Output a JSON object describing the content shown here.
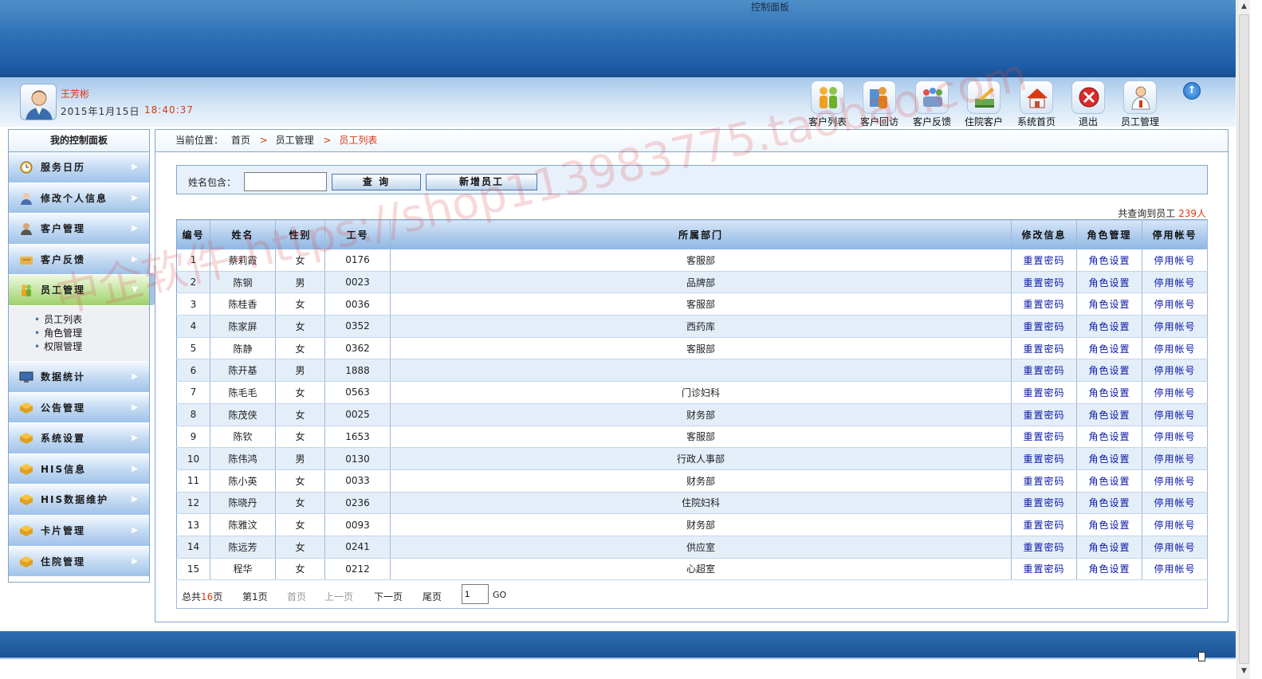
{
  "banner": {
    "title": "控制面板"
  },
  "user": {
    "name": "王芳彬",
    "date": "2015年1月15日",
    "time": "18:40:37"
  },
  "toolbar": [
    {
      "label": "客户列表",
      "icon": "customer-list-icon"
    },
    {
      "label": "客户回访",
      "icon": "customer-visit-icon"
    },
    {
      "label": "客户反馈",
      "icon": "customer-feedback-icon"
    },
    {
      "label": "住院客户",
      "icon": "inpatient-icon"
    },
    {
      "label": "系统首页",
      "icon": "home-icon"
    },
    {
      "label": "退出",
      "icon": "exit-icon"
    },
    {
      "label": "员工管理",
      "icon": "staff-icon"
    }
  ],
  "sidebar": {
    "title": "我的控制面板",
    "items": [
      {
        "label": "服务日历",
        "icon": "clock-icon"
      },
      {
        "label": "修改个人信息",
        "icon": "person-icon"
      },
      {
        "label": "客户管理",
        "icon": "customer-icon"
      },
      {
        "label": "客户反馈",
        "icon": "feedback-icon"
      },
      {
        "label": "员工管理",
        "icon": "staff-icon"
      },
      {
        "label": "数据统计",
        "icon": "monitor-icon"
      },
      {
        "label": "公告管理",
        "icon": "folder-icon"
      },
      {
        "label": "系统设置",
        "icon": "folder-icon"
      },
      {
        "label": "HIS信息",
        "icon": "folder-icon"
      },
      {
        "label": "HIS数据维护",
        "icon": "folder-icon"
      },
      {
        "label": "卡片管理",
        "icon": "folder-icon"
      },
      {
        "label": "住院管理",
        "icon": "folder-icon"
      }
    ],
    "submenu": [
      "员工列表",
      "角色管理",
      "权限管理"
    ]
  },
  "breadcrumb": {
    "prefix": "当前位置：",
    "home": "首页",
    "section": "员工管理",
    "current": "员工列表",
    "separator": ">"
  },
  "search": {
    "label": "姓名包含：",
    "value": "",
    "query_button": "查 询",
    "add_button": "新增员工"
  },
  "summary": {
    "prefix": "共查询到员工",
    "count": "239",
    "suffix": "人"
  },
  "table": {
    "headers": [
      "编号",
      "姓名",
      "性别",
      "工号",
      "所属部门",
      "修改信息",
      "角色管理",
      "停用帐号"
    ],
    "action_labels": [
      "重置密码",
      "角色设置",
      "停用帐号"
    ],
    "rows": [
      [
        "1",
        "蔡莉霞",
        "女",
        "0176",
        "客服部"
      ],
      [
        "2",
        "陈钢",
        "男",
        "0023",
        "品牌部"
      ],
      [
        "3",
        "陈桂香",
        "女",
        "0036",
        "客服部"
      ],
      [
        "4",
        "陈家屏",
        "女",
        "0352",
        "西药库"
      ],
      [
        "5",
        "陈静",
        "女",
        "0362",
        "客服部"
      ],
      [
        "6",
        "陈开基",
        "男",
        "1888",
        ""
      ],
      [
        "7",
        "陈毛毛",
        "女",
        "0563",
        "门诊妇科"
      ],
      [
        "8",
        "陈茂侠",
        "女",
        "0025",
        "财务部"
      ],
      [
        "9",
        "陈钦",
        "女",
        "1653",
        "客服部"
      ],
      [
        "10",
        "陈伟鸿",
        "男",
        "0130",
        "行政人事部"
      ],
      [
        "11",
        "陈小英",
        "女",
        "0033",
        "财务部"
      ],
      [
        "12",
        "陈晓丹",
        "女",
        "0236",
        "住院妇科"
      ],
      [
        "13",
        "陈雅汶",
        "女",
        "0093",
        "财务部"
      ],
      [
        "14",
        "陈远芳",
        "女",
        "0241",
        "供应室"
      ],
      [
        "15",
        "程华",
        "女",
        "0212",
        "心超室"
      ]
    ]
  },
  "pager": {
    "total_prefix": "总共",
    "total_pages": "16",
    "total_suffix": "页",
    "current": "第1页",
    "first": "首页",
    "prev": "上一页",
    "next": "下一页",
    "last": "尾页",
    "page_input": "1",
    "go": "GO"
  },
  "watermark": "中企软件-https://shop113983775.taobao.com",
  "colors": {
    "accent_red": "#d83a12",
    "link_blue": "#0a17a8",
    "banner_blue": "#2f72b6"
  }
}
